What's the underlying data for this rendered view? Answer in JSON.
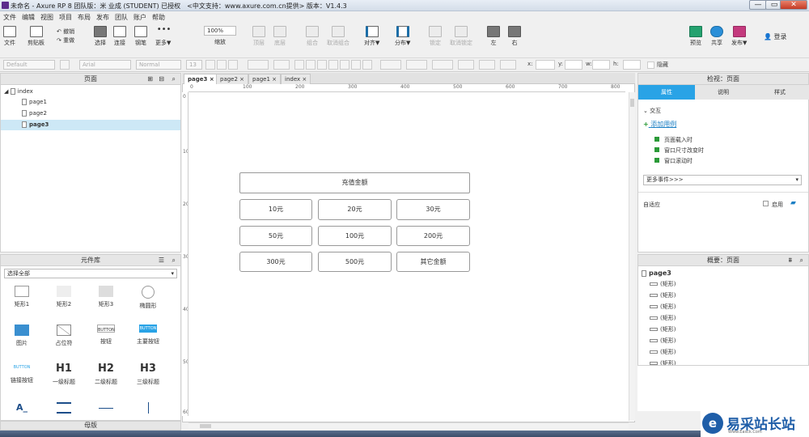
{
  "window": {
    "title": "未命名 - Axure RP 8 团队版：米 业成 (STUDENT) 已授权　<中文支持：www.axure.com.cn提供> 版本：V1.4.3",
    "minimize": "—",
    "maximize": "▭",
    "close": "✕"
  },
  "menu": [
    "文件",
    "编辑",
    "视图",
    "项目",
    "布局",
    "发布",
    "团队",
    "账户",
    "帮助"
  ],
  "toolbar": {
    "file": "文件",
    "clipboard": "剪贴板",
    "undo": "撤销",
    "redo": "重做",
    "select": "选择",
    "connect": "连接",
    "pen": "钢笔",
    "more": "更多▼",
    "zoom_value": "100%",
    "zoom_label": "缩放",
    "top": "顶层",
    "bottom": "底层",
    "group": "组合",
    "ungroup": "取消组合",
    "align": "对齐▼",
    "distribute": "分布▼",
    "lock": "锁定",
    "unlock": "取消锁定",
    "left": "左",
    "right": "右",
    "preview": "预览",
    "share": "共享",
    "publish": "发布▼",
    "login": "登录"
  },
  "stylebar": {
    "style": "Default",
    "font": "Arial",
    "weight": "Normal",
    "size": "13",
    "x_label": "x:",
    "y_label": "y:",
    "w_label": "w:",
    "h_label": "h:",
    "hide": "隐藏"
  },
  "pages_panel": {
    "title": "页面",
    "items": [
      {
        "label": "index",
        "level": 0
      },
      {
        "label": "page1",
        "level": 1
      },
      {
        "label": "page2",
        "level": 1
      },
      {
        "label": "page3",
        "level": 1,
        "selected": true
      }
    ]
  },
  "library_panel": {
    "title": "元件库",
    "filter": "选择全部",
    "widgets": [
      "矩形1",
      "矩形2",
      "矩形3",
      "椭圆形",
      "图片",
      "占位符",
      "按钮",
      "主要按钮",
      "链接按钮",
      "一级标题",
      "二级标题",
      "三级标题"
    ],
    "button_text": "BUTTON",
    "heading_marks": [
      "H1",
      "H2",
      "H3"
    ],
    "text_marks": [
      "A_"
    ]
  },
  "masters_panel": {
    "title": "母版"
  },
  "tabs": [
    "page3",
    "page2",
    "page1",
    "index"
  ],
  "ruler_h": [
    "0",
    "100",
    "200",
    "300",
    "400",
    "500",
    "600",
    "700",
    "800"
  ],
  "ruler_v": [
    "0",
    "100",
    "200",
    "300",
    "400",
    "500",
    "600"
  ],
  "canvas": {
    "header": "充值金额",
    "buttons": [
      "10元",
      "20元",
      "30元",
      "50元",
      "100元",
      "200元",
      "300元",
      "500元",
      "其它金额"
    ]
  },
  "inspector": {
    "title": "检视：页面",
    "tabs": [
      "属性",
      "说明",
      "样式"
    ],
    "section": "交互",
    "add_case": "添加用例",
    "events": [
      "页面载入时",
      "窗口尺寸改变时",
      "窗口滚动时"
    ],
    "more_events": "更多事件>>>",
    "adaptive": "自适应",
    "enable": "启用"
  },
  "outline": {
    "title": "概要：页面",
    "root": "page3",
    "item_label": "(矩形)",
    "count": 8
  },
  "watermark": {
    "main": "易采站长站",
    "sub": "Www.Easck.Com"
  },
  "colors": {
    "accent": "#29a3e6",
    "selection": "#cde8f6"
  }
}
